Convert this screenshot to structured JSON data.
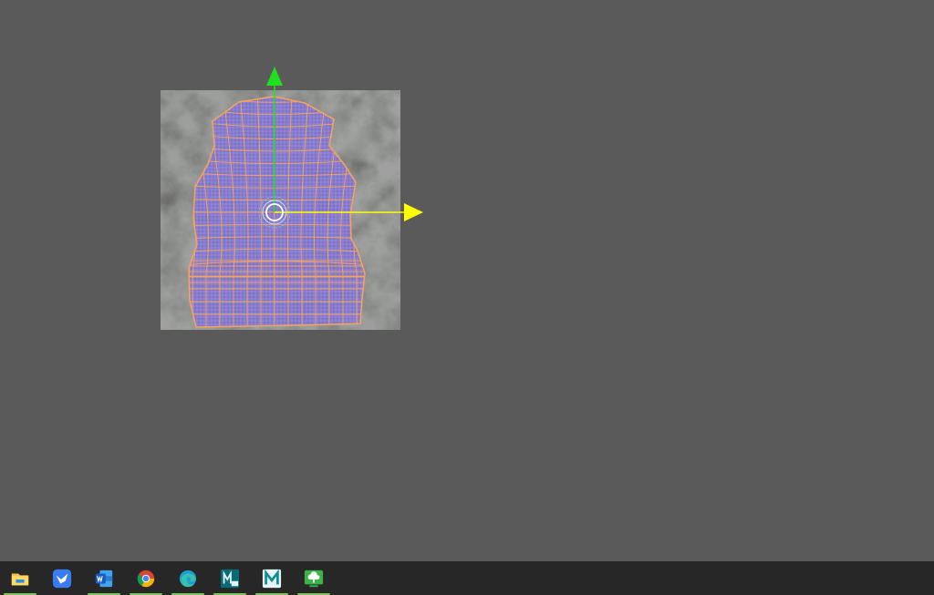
{
  "viewport": {
    "background_color": "#5a5a5a",
    "texture_name": "concrete-texture",
    "uv_shell": {
      "fill_color": "#7a6fd0",
      "edge_color": "#f3a35e"
    },
    "gizmo": {
      "v_axis_color": "#1fe01f",
      "u_axis_color": "#ffff00",
      "pivot_color": "#7fd4e8"
    }
  },
  "taskbar": {
    "background_color": "#272727",
    "running_indicator_color": "#7dc35b",
    "apps": [
      {
        "icon": "file-explorer-icon",
        "running": true
      },
      {
        "icon": "feishu-bird-icon",
        "running": false
      },
      {
        "icon": "word-icon",
        "running": true
      },
      {
        "icon": "chrome-icon",
        "running": true
      },
      {
        "icon": "edge-icon",
        "running": true
      },
      {
        "icon": "maya-2024-icon",
        "running": true
      },
      {
        "icon": "maya-icon",
        "running": true
      },
      {
        "icon": "cloud-desktop-icon",
        "running": true
      }
    ]
  }
}
